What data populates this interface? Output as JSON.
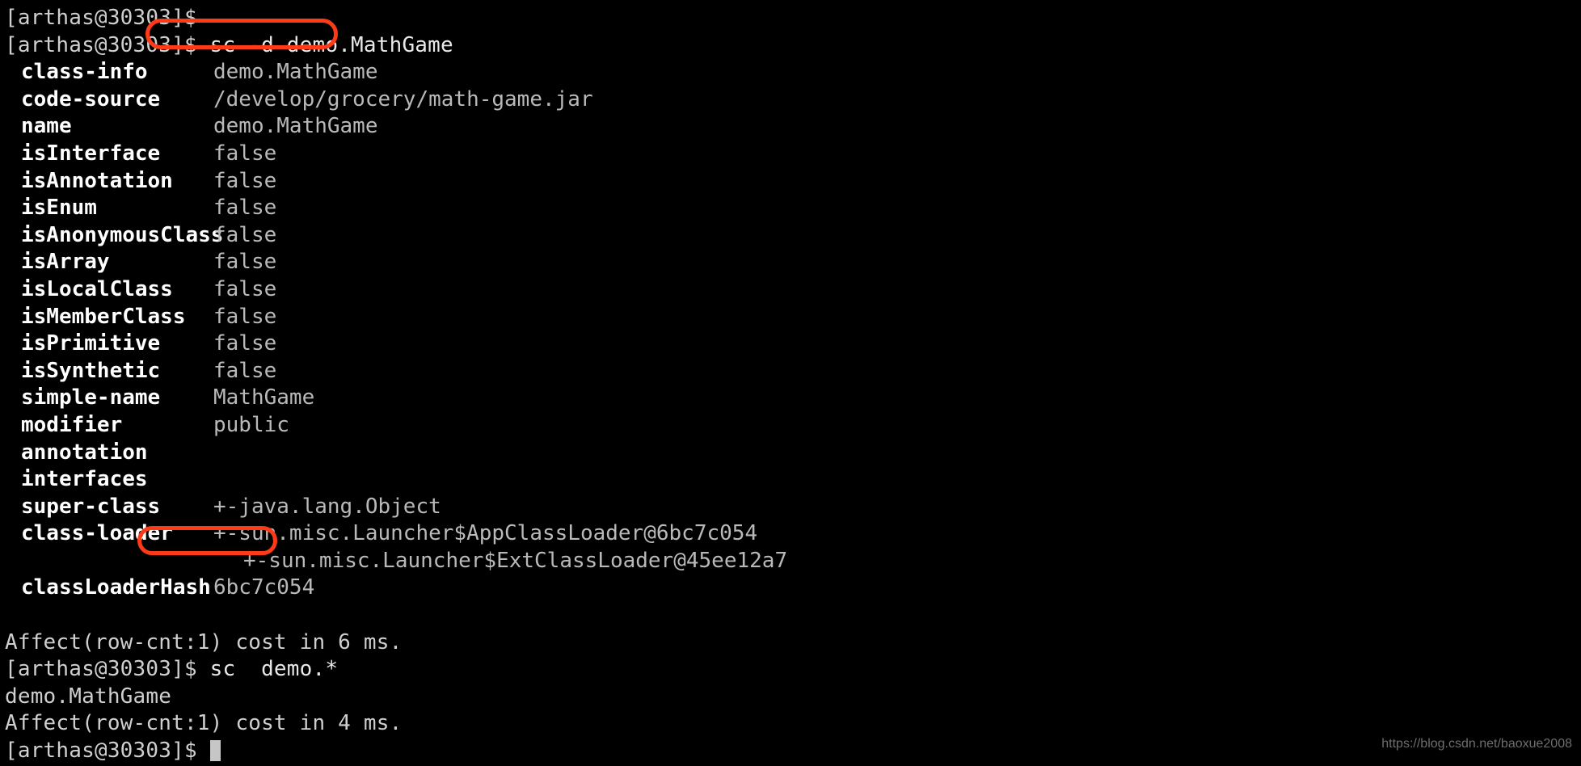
{
  "terminal": {
    "prompt": "[arthas@30303]$",
    "background_color": "#000000",
    "text_color": "#cfcfcf",
    "key_color": "#ffffff",
    "value_color": "#b9b9b9",
    "highlight_color": "#ff3a16"
  },
  "session": {
    "line_1_prompt": "[arthas@30303]$",
    "line_2_prompt": "[arthas@30303]$ ",
    "command_1": "sc -d demo.MathGame",
    "command_2": "sc  demo.*",
    "line_bottom_prompt": "[arthas@30303]$ "
  },
  "class_info": {
    "rows": [
      {
        "key": "class-info",
        "value": "demo.MathGame"
      },
      {
        "key": "code-source",
        "value": "/develop/grocery/math-game.jar"
      },
      {
        "key": "name",
        "value": "demo.MathGame"
      },
      {
        "key": "isInterface",
        "value": "false"
      },
      {
        "key": "isAnnotation",
        "value": "false"
      },
      {
        "key": "isEnum",
        "value": "false"
      },
      {
        "key": "isAnonymousClass",
        "value": "false"
      },
      {
        "key": "isArray",
        "value": "false"
      },
      {
        "key": "isLocalClass",
        "value": "false"
      },
      {
        "key": "isMemberClass",
        "value": "false"
      },
      {
        "key": "isPrimitive",
        "value": "false"
      },
      {
        "key": "isSynthetic",
        "value": "false"
      },
      {
        "key": "simple-name",
        "value": "MathGame"
      },
      {
        "key": "modifier",
        "value": "public"
      },
      {
        "key": "annotation",
        "value": ""
      },
      {
        "key": "interfaces",
        "value": ""
      },
      {
        "key": "super-class",
        "value": "+-java.lang.Object"
      },
      {
        "key": "class-loader",
        "value": "+-sun.misc.Launcher$AppClassLoader@6bc7c054"
      }
    ],
    "class_loader_child": "+-sun.misc.Launcher$ExtClassLoader@45ee12a7",
    "class_loader_hash_key": "classLoaderHash",
    "class_loader_hash_value": "6bc7c054"
  },
  "results": {
    "affect_1": "Affect(row-cnt:1) cost in 6 ms.",
    "sc_match": "demo.MathGame",
    "affect_2": "Affect(row-cnt:1) cost in 4 ms."
  },
  "watermark": {
    "text": "https://blog.csdn.net/baoxue2008"
  }
}
